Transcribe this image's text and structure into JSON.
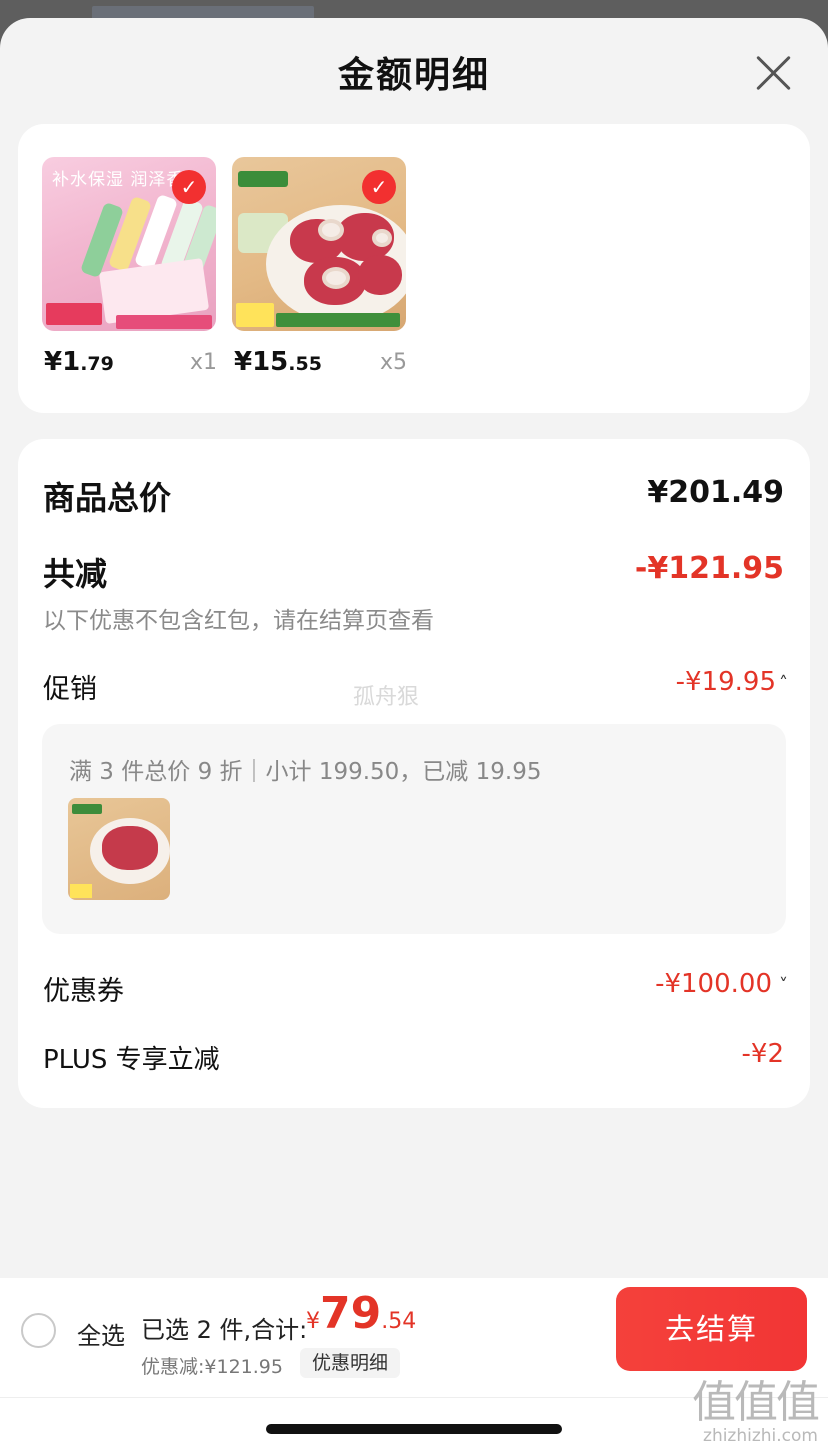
{
  "sheet": {
    "title": "金额明细"
  },
  "products": [
    {
      "image_text": "补水保湿 润泽香",
      "price_main": "¥1",
      "price_decimal": ".79",
      "qty": "x1"
    },
    {
      "price_main": "¥15",
      "price_decimal": ".55",
      "qty": "x5"
    }
  ],
  "summary": {
    "total_label": "商品总价",
    "total_value": "¥201.49",
    "reduce_label": "共减",
    "reduce_value": "-¥121.95",
    "reduce_note": "以下优惠不包含红包，请在结算页查看",
    "promo_label": "促销",
    "promo_value": "-¥19.95",
    "watermark": "孤舟狠",
    "promo_detail": "满 3 件总价 9 折｜小计 199.50，已减 19.95",
    "coupon_label": "优惠券",
    "coupon_value": "-¥100.00",
    "plus_label": "PLUS 专享立减",
    "plus_value": "-¥2"
  },
  "footer": {
    "select_all": "全选",
    "selected_text": "已选 2 件,合计:",
    "currency": "¥",
    "total_int": "79",
    "total_dec": ".54",
    "discount_text": "优惠减:¥121.95",
    "detail_chip": "优惠明细",
    "checkout": "去结算",
    "site_glyphs": "值值值",
    "site_url": "zhizhizhi.com"
  },
  "colors": {
    "accent_red": "#e33427",
    "checkout_red": "#f23535",
    "sheet_bg": "#f3f3f3"
  }
}
